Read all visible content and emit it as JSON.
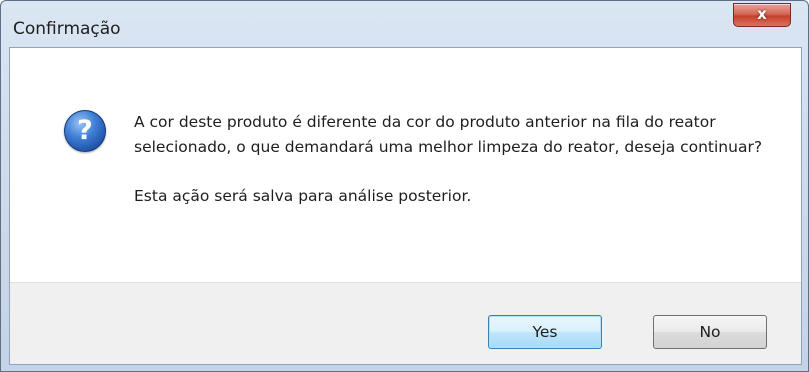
{
  "window": {
    "title": "Confirmação",
    "close_label": "x"
  },
  "dialog": {
    "icon": "question-icon",
    "message": "A cor deste produto é diferente da cor do produto anterior na fila do reator selecionado, o que demandará uma melhor limpeza do reator, deseja continuar?",
    "note": "Esta ação será salva para análise posterior."
  },
  "buttons": {
    "yes_label": "Yes",
    "no_label": "No",
    "default": "yes"
  },
  "colors": {
    "title_bar": "#cfdcec",
    "close_button": "#c4412b",
    "footer": "#f0f0f0",
    "icon_blue": "#1d4fa3"
  }
}
